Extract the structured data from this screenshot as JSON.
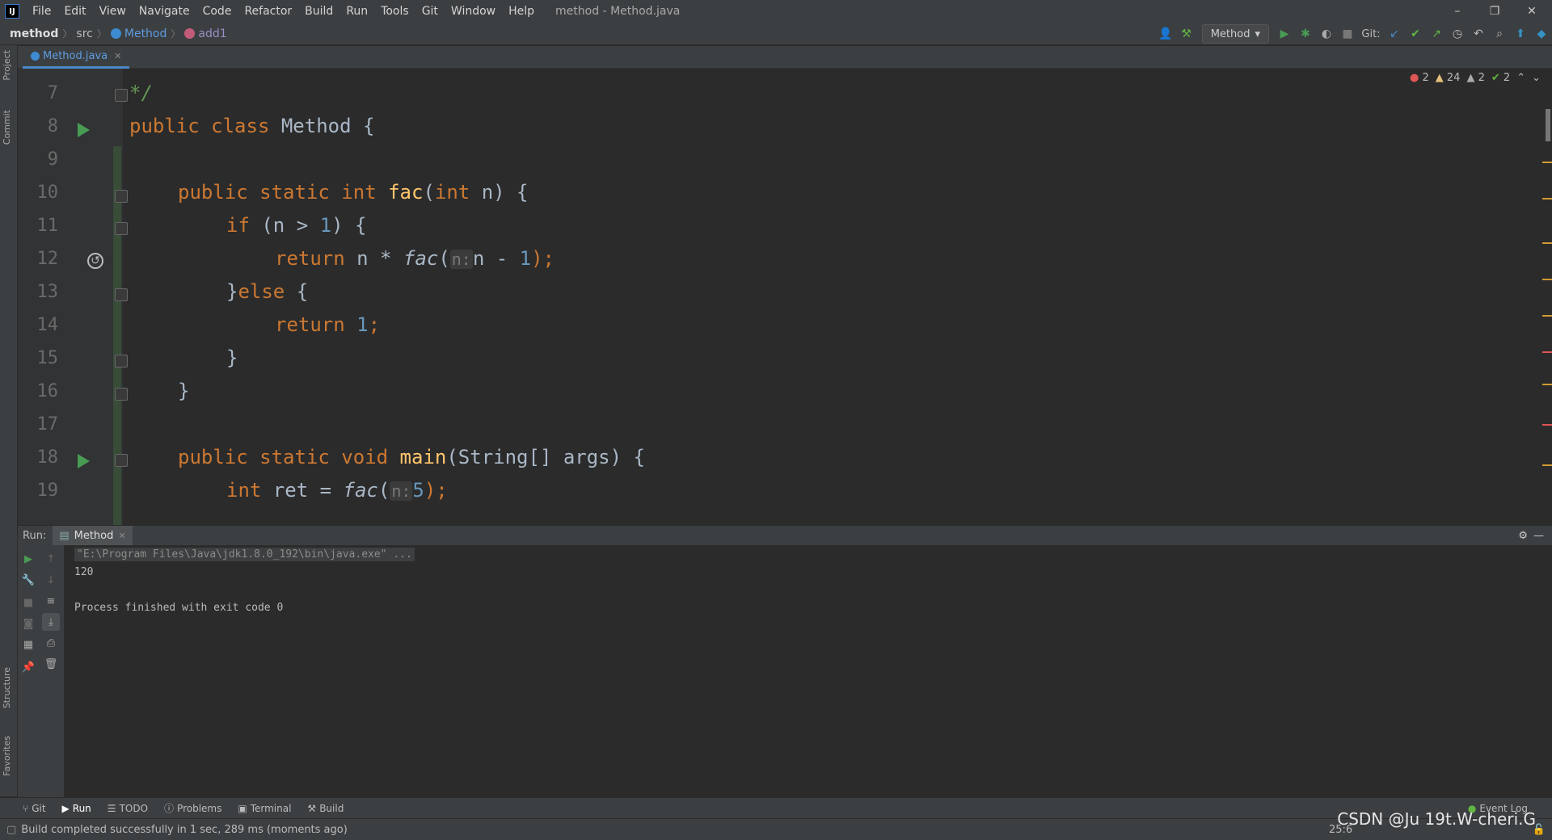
{
  "window": {
    "title": "method - Method.java",
    "menu": [
      "File",
      "Edit",
      "View",
      "Navigate",
      "Code",
      "Refactor",
      "Build",
      "Run",
      "Tools",
      "Git",
      "Window",
      "Help"
    ],
    "controls": {
      "minimize": "–",
      "restore": "❐",
      "close": "✕"
    }
  },
  "breadcrumb": {
    "project": "method",
    "folder": "src",
    "class": "Method",
    "method": "add1"
  },
  "toolbar": {
    "run_config": "Method",
    "git_label": "Git:"
  },
  "side_tabs": {
    "left_top": [
      "Project",
      "Commit"
    ],
    "left_bottom": [
      "Structure",
      "Favorites"
    ]
  },
  "editor": {
    "tab_label": "Method.java",
    "inspections": {
      "errors": "2",
      "warnings": "24",
      "weak": "2",
      "ok": "2"
    },
    "lines": [
      {
        "n": "7",
        "text": "*/"
      },
      {
        "n": "8",
        "text": "public class Method {"
      },
      {
        "n": "9",
        "text": ""
      },
      {
        "n": "10",
        "text": "public static int fac(int n) {"
      },
      {
        "n": "11",
        "text": "if (n > 1) {"
      },
      {
        "n": "12",
        "text": "return n * fac(n: n - 1);"
      },
      {
        "n": "13",
        "text": "}else {"
      },
      {
        "n": "14",
        "text": "return 1;"
      },
      {
        "n": "15",
        "text": "}"
      },
      {
        "n": "16",
        "text": "}"
      },
      {
        "n": "17",
        "text": ""
      },
      {
        "n": "18",
        "text": "public static void main(String[] args) {"
      },
      {
        "n": "19",
        "text": "int ret = fac(n: 5);"
      }
    ]
  },
  "run_panel": {
    "label": "Run:",
    "tab": "Method",
    "console": {
      "command": "\"E:\\Program Files\\Java\\jdk1.8.0_192\\bin\\java.exe\" ...",
      "output": "120",
      "exit": "Process finished with exit code 0"
    }
  },
  "bottom_tabs": [
    "Git",
    "Run",
    "TODO",
    "Problems",
    "Terminal",
    "Build"
  ],
  "event_log": "Event Log",
  "status": {
    "message": "Build completed successfully in 1 sec, 289 ms (moments ago)",
    "position": "25:6"
  },
  "watermark": "CSDN @Ju 19t.W-cheri.G",
  "colors": {
    "keyword": "#cc7832",
    "number": "#6897bb",
    "function": "#ffc66d",
    "comment": "#629755",
    "run_green": "#499c54",
    "accent_blue": "#4a88c7"
  }
}
